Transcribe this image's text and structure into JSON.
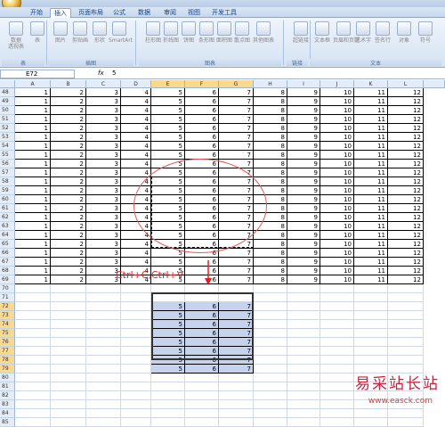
{
  "ribbon_tabs": [
    "开始",
    "插入",
    "页面布局",
    "公式",
    "数据",
    "审阅",
    "视图",
    "开发工具"
  ],
  "active_tab": "插入",
  "ribbon_buttons": [
    {
      "label": "数据\n透视表",
      "icon": "pivot-table-icon"
    },
    {
      "label": "表",
      "icon": "table-icon"
    },
    {
      "label": "图片",
      "icon": "picture-icon"
    },
    {
      "label": "剪贴画",
      "icon": "clipart-icon"
    },
    {
      "label": "形状",
      "icon": "shapes-icon"
    },
    {
      "label": "SmartArt",
      "icon": "smartart-icon"
    },
    {
      "label": "柱形图",
      "icon": "column-chart-icon"
    },
    {
      "label": "折线图",
      "icon": "line-chart-icon"
    },
    {
      "label": "饼图",
      "icon": "pie-chart-icon"
    },
    {
      "label": "条形图",
      "icon": "bar-chart-icon"
    },
    {
      "label": "面积图",
      "icon": "area-chart-icon"
    },
    {
      "label": "散点图",
      "icon": "scatter-chart-icon"
    },
    {
      "label": "其他图表",
      "icon": "other-chart-icon"
    },
    {
      "label": "超链接",
      "icon": "hyperlink-icon"
    },
    {
      "label": "文本框",
      "icon": "textbox-icon"
    },
    {
      "label": "页眉和页脚",
      "icon": "header-footer-icon"
    },
    {
      "label": "艺术字",
      "icon": "wordart-icon"
    },
    {
      "label": "签名行",
      "icon": "signature-icon"
    },
    {
      "label": "对象",
      "icon": "object-icon"
    },
    {
      "label": "符号",
      "icon": "symbol-icon"
    }
  ],
  "ribbon_groups": [
    "表",
    "插图",
    "图表",
    "链接",
    "文本"
  ],
  "name_box": "E72",
  "fx_label": "fx",
  "formula_value": "5",
  "columns": [
    "A",
    "B",
    "C",
    "D",
    "E",
    "F",
    "G",
    "H",
    "I",
    "J",
    "K",
    "L"
  ],
  "rows_filled": [
    "48",
    "49",
    "50",
    "51",
    "52",
    "53",
    "54",
    "55",
    "56",
    "57",
    "58",
    "59",
    "60",
    "61",
    "62",
    "63",
    "64",
    "65",
    "66",
    "67",
    "68",
    "69"
  ],
  "row_values": [
    "1",
    "2",
    "3",
    "4",
    "5",
    "6",
    "7",
    "8",
    "9",
    "10",
    "11",
    "12"
  ],
  "rows_empty_top": [
    "70",
    "71"
  ],
  "rows_pasted": [
    "72",
    "73",
    "74",
    "75",
    "76",
    "77",
    "78",
    "79"
  ],
  "pasted_values": [
    "5",
    "6",
    "7"
  ],
  "rows_empty_bottom": [
    "80",
    "81",
    "82",
    "83",
    "84",
    "85"
  ],
  "annotation": "Ctrl+C,Ctrl+V",
  "watermark_cn": "易采站长站",
  "watermark_url": "www.easck.com",
  "colors": {
    "annotation": "#e02020",
    "selection": "#c5d3ec",
    "header_selected": "#f8d98d"
  }
}
